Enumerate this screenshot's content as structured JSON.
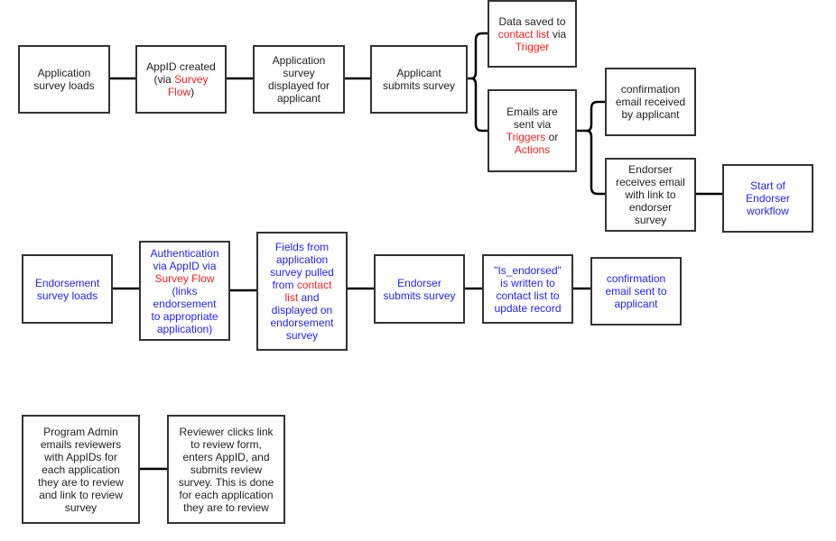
{
  "colors": {
    "border": "#333333",
    "text": "#222222",
    "highlight_red": "#ff1a1a",
    "highlight_blue": "#2222ff"
  },
  "boxes": [
    {
      "id": "application-survey-loads",
      "lines": [
        [
          {
            "text": "Application"
          }
        ],
        [
          {
            "text": "survey loads"
          }
        ]
      ]
    },
    {
      "id": "appid-created",
      "lines": [
        [
          {
            "text": "AppID created"
          }
        ],
        [
          {
            "text": "(via "
          },
          {
            "text": "Survey",
            "red": true
          }
        ],
        [
          {
            "text": "Flow",
            "red": true
          },
          {
            "text": ")"
          }
        ]
      ]
    },
    {
      "id": "application-survey-displayed",
      "lines": [
        [
          {
            "text": "Application"
          }
        ],
        [
          {
            "text": "survey"
          }
        ],
        [
          {
            "text": "displayed for"
          }
        ],
        [
          {
            "text": "applicant"
          }
        ]
      ]
    },
    {
      "id": "applicant-submits-survey",
      "lines": [
        [
          {
            "text": "Applicant"
          }
        ],
        [
          {
            "text": "submits survey"
          }
        ]
      ]
    },
    {
      "id": "data-saved-contact-list",
      "lines": [
        [
          {
            "text": "Data saved to"
          }
        ],
        [
          {
            "text": "contact list",
            "red": true
          },
          {
            "text": " via"
          }
        ],
        [
          {
            "text": "Trigger",
            "red": true
          }
        ]
      ]
    },
    {
      "id": "emails-sent",
      "lines": [
        [
          {
            "text": "Emails are"
          }
        ],
        [
          {
            "text": "sent via"
          }
        ],
        [
          {
            "text": "Triggers",
            "red": true
          },
          {
            "text": " or"
          }
        ],
        [
          {
            "text": "Actions",
            "red": true
          }
        ]
      ]
    },
    {
      "id": "confirmation-email-received",
      "lines": [
        [
          {
            "text": "confirmation"
          }
        ],
        [
          {
            "text": "email received"
          }
        ],
        [
          {
            "text": "by applicant"
          }
        ]
      ]
    },
    {
      "id": "endorser-receives-email",
      "lines": [
        [
          {
            "text": "Endorser"
          }
        ],
        [
          {
            "text": "receives email"
          }
        ],
        [
          {
            "text": "with link to"
          }
        ],
        [
          {
            "text": "endorser"
          }
        ],
        [
          {
            "text": "survey"
          }
        ]
      ]
    },
    {
      "id": "start-of-endorser-workflow",
      "blue": true,
      "lines": [
        [
          {
            "text": "Start of"
          }
        ],
        [
          {
            "text": "Endorser"
          }
        ],
        [
          {
            "text": "workflow"
          }
        ]
      ]
    },
    {
      "id": "endorsement-survey-loads",
      "blue": true,
      "lines": [
        [
          {
            "text": "Endorsement"
          }
        ],
        [
          {
            "text": "survey loads"
          }
        ]
      ]
    },
    {
      "id": "authentication-via-appid",
      "blue": true,
      "lines": [
        [
          {
            "text": "Authentication"
          }
        ],
        [
          {
            "text": "via AppID via"
          }
        ],
        [
          {
            "text": "Survey Flow",
            "red": true
          }
        ],
        [
          {
            "text": "(links"
          }
        ],
        [
          {
            "text": "endorsement"
          }
        ],
        [
          {
            "text": "to appropriate"
          }
        ],
        [
          {
            "text": "application)"
          }
        ]
      ]
    },
    {
      "id": "fields-pulled-from-contact-list",
      "blue": true,
      "lines": [
        [
          {
            "text": "Fields from"
          }
        ],
        [
          {
            "text": "application"
          }
        ],
        [
          {
            "text": "survey pulled"
          }
        ],
        [
          {
            "text": "from "
          },
          {
            "text": "contact",
            "red": true
          }
        ],
        [
          {
            "text": "list",
            "red": true
          },
          {
            "text": " and"
          }
        ],
        [
          {
            "text": "displayed on"
          }
        ],
        [
          {
            "text": "endorsement"
          }
        ],
        [
          {
            "text": "survey"
          }
        ]
      ]
    },
    {
      "id": "endorser-submits-survey",
      "blue": true,
      "lines": [
        [
          {
            "text": "Endorser"
          }
        ],
        [
          {
            "text": "submits survey"
          }
        ]
      ]
    },
    {
      "id": "is-endorsed-written",
      "blue": true,
      "lines": [
        [
          {
            "text": "\"Is_endorsed\""
          }
        ],
        [
          {
            "text": "is written to"
          }
        ],
        [
          {
            "text": "contact list to"
          }
        ],
        [
          {
            "text": "update record"
          }
        ]
      ]
    },
    {
      "id": "confirmation-email-sent",
      "blue": true,
      "lines": [
        [
          {
            "text": "confirmation"
          }
        ],
        [
          {
            "text": "email sent to"
          }
        ],
        [
          {
            "text": "applicant"
          }
        ]
      ]
    },
    {
      "id": "program-admin-emails-reviewers",
      "lines": [
        [
          {
            "text": "Program Admin"
          }
        ],
        [
          {
            "text": "emails reviewers"
          }
        ],
        [
          {
            "text": "with AppIDs for"
          }
        ],
        [
          {
            "text": "each application"
          }
        ],
        [
          {
            "text": "they are to review"
          }
        ],
        [
          {
            "text": "and link to review"
          }
        ],
        [
          {
            "text": "survey"
          }
        ]
      ]
    },
    {
      "id": "reviewer-clicks-link",
      "lines": [
        [
          {
            "text": "Reviewer clicks link"
          }
        ],
        [
          {
            "text": "to review form,"
          }
        ],
        [
          {
            "text": "enters AppID, and"
          }
        ],
        [
          {
            "text": "submits review"
          }
        ],
        [
          {
            "text": "survey. This is done"
          }
        ],
        [
          {
            "text": "for each application"
          }
        ],
        [
          {
            "text": "they are to review"
          }
        ]
      ]
    }
  ]
}
